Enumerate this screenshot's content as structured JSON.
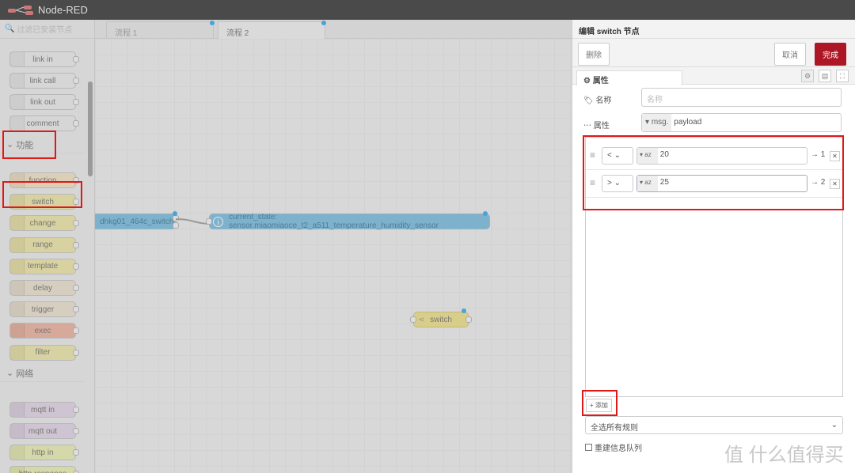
{
  "app": {
    "title": "Node-RED"
  },
  "palette": {
    "filter_placeholder": "过滤已安装节点",
    "nodes_top": [
      "link in",
      "link call",
      "link out",
      "comment"
    ],
    "section_function": "功能",
    "nodes_function": [
      "function",
      "switch",
      "change",
      "range",
      "template",
      "delay",
      "trigger",
      "exec",
      "filter"
    ],
    "section_network": "网络",
    "nodes_network": [
      "mqtt in",
      "mqtt out",
      "http in",
      "http response"
    ]
  },
  "tabs": [
    {
      "label": "流程 1"
    },
    {
      "label": "流程 2"
    }
  ],
  "canvas": {
    "nodes": [
      "dhkg01_464c_switch",
      "current_state: sensor.miaomiaoce_t2_a511_temperature_humidity_sensor",
      "switch"
    ]
  },
  "editor": {
    "title": "编辑 switch 节点",
    "delete": "删除",
    "cancel": "取消",
    "done": "完成",
    "tab_props": "属性",
    "name_label": "名称",
    "name_placeholder": "名称",
    "property_label": "属性",
    "property_prefix": "msg.",
    "property_value": "payload",
    "rules": [
      {
        "op": "<",
        "value": "20",
        "output": "→ 1"
      },
      {
        "op": ">",
        "value": "25",
        "output": "→ 2"
      }
    ],
    "add": "添加",
    "mode": "全选所有规则",
    "recreate": "重建信息队列"
  },
  "watermark": "值 什么值得买",
  "colors": {
    "accent": "#ad1625",
    "highlight": "#e01818",
    "flow_node": "#7eb2cc"
  }
}
